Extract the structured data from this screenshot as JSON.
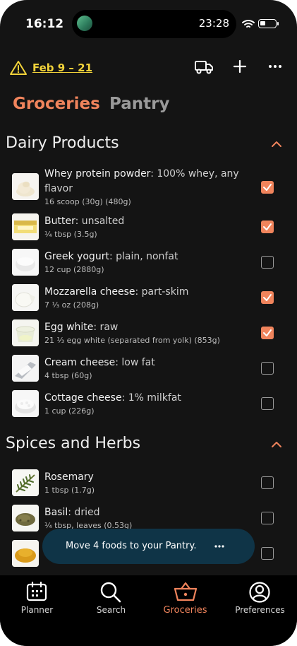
{
  "status_bar": {
    "time": "16:12",
    "island_time": "23:28"
  },
  "header": {
    "date_range": "Feb 9 – 21"
  },
  "tabs": [
    {
      "label": "Groceries",
      "active": true
    },
    {
      "label": "Pantry",
      "active": false
    }
  ],
  "sections": [
    {
      "title": "Dairy Products",
      "items": [
        {
          "name": "Whey protein powder",
          "desc": ": 100% whey, any flavor",
          "qty": "16 scoop (30g) (480g)",
          "checked": true
        },
        {
          "name": "Butter",
          "desc": ": unsalted",
          "qty": "¼ tbsp (3.5g)",
          "checked": true
        },
        {
          "name": "Greek yogurt",
          "desc": ": plain, nonfat",
          "qty": "12 cup (2880g)",
          "checked": false
        },
        {
          "name": "Mozzarella cheese",
          "desc": ": part-skim",
          "qty": "7 ⅓ oz (208g)",
          "checked": true
        },
        {
          "name": "Egg white",
          "desc": ": raw",
          "qty": "21 ⅓ egg white (separated from yolk) (853g)",
          "checked": true
        },
        {
          "name": "Cream cheese",
          "desc": ": low fat",
          "qty": "4 tbsp (60g)",
          "checked": false
        },
        {
          "name": "Cottage cheese",
          "desc": ": 1% milkfat",
          "qty": "1 cup (226g)",
          "checked": false
        }
      ]
    },
    {
      "title": "Spices and Herbs",
      "items": [
        {
          "name": "Rosemary",
          "desc": "",
          "qty": "1 tbsp (1.7g)",
          "checked": false
        },
        {
          "name": "Basil",
          "desc": ": dried",
          "qty": "¼ tbsp, leaves (0.53g)",
          "checked": false
        },
        {
          "name": "",
          "desc": "",
          "qty": "",
          "checked": false
        }
      ]
    }
  ],
  "toast": {
    "text": "Move 4 foods to your Pantry."
  },
  "nav": [
    {
      "label": "Planner",
      "icon": "calendar-icon",
      "active": false
    },
    {
      "label": "Search",
      "icon": "search-icon",
      "active": false
    },
    {
      "label": "Groceries",
      "icon": "basket-icon",
      "active": true
    },
    {
      "label": "Preferences",
      "icon": "user-circle-icon",
      "active": false
    }
  ],
  "colors": {
    "accent": "#f0845c",
    "warning": "#f2d33a",
    "toast_bg": "#0f3447"
  }
}
